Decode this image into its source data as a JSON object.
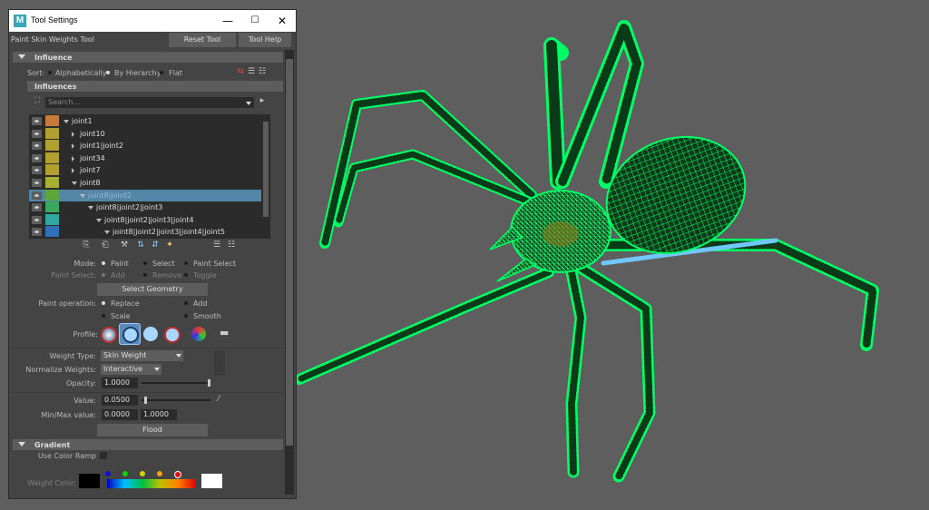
{
  "window": {
    "title": "Tool Settings",
    "logo_letter": "M",
    "minimize": "—",
    "maximize": "☐",
    "close": "✕"
  },
  "tool": {
    "name": "Paint Skin Weights Tool",
    "reset_label": "Reset Tool",
    "help_label": "Tool Help"
  },
  "influence": {
    "header": "Influence",
    "sort_label": "Sort:",
    "sort_options": [
      "Alphabetically",
      "By Hierarchy",
      "Flat"
    ],
    "sort_selected": "By Hierarchy",
    "influences_header": "Influences",
    "search_placeholder": "Search...",
    "tree": [
      {
        "name": "joint1",
        "color": "#c87a3a",
        "indent": 0,
        "arrow": "expanded",
        "selected": false
      },
      {
        "name": "joint10",
        "color": "#b0a030",
        "indent": 1,
        "arrow": "collapsed",
        "selected": false
      },
      {
        "name": "joint1|joint2",
        "color": "#b0a030",
        "indent": 1,
        "arrow": "collapsed",
        "selected": false
      },
      {
        "name": "joint34",
        "color": "#b0a030",
        "indent": 1,
        "arrow": "collapsed",
        "selected": false
      },
      {
        "name": "joint7",
        "color": "#b0a030",
        "indent": 1,
        "arrow": "collapsed",
        "selected": false
      },
      {
        "name": "joint8",
        "color": "#a8b030",
        "indent": 1,
        "arrow": "expanded",
        "selected": false
      },
      {
        "name": "joint8|joint2",
        "color": "#5aa83a",
        "indent": 2,
        "arrow": "expanded",
        "selected": true
      },
      {
        "name": "joint8|joint2|joint3",
        "color": "#3aa860",
        "indent": 3,
        "arrow": "expanded",
        "selected": false
      },
      {
        "name": "joint8|joint2|joint3|joint4",
        "color": "#30a8a0",
        "indent": 4,
        "arrow": "expanded",
        "selected": false
      },
      {
        "name": "joint8|joint2|joint3|joint4|joint5",
        "color": "#3070b8",
        "indent": 5,
        "arrow": "expanded",
        "selected": false
      }
    ]
  },
  "mode": {
    "label": "Mode:",
    "options": [
      "Paint",
      "Select",
      "Paint Select"
    ],
    "selected": "Paint",
    "paint_select_label": "Paint Select:",
    "paint_select_options": [
      "Add",
      "Remove",
      "Toggle"
    ],
    "select_geometry": "Select Geometry"
  },
  "paint_operation": {
    "label": "Paint operation:",
    "options": [
      "Replace",
      "Add",
      "Scale",
      "Smooth"
    ],
    "selected": "Replace"
  },
  "profile": {
    "label": "Profile:"
  },
  "weights": {
    "weight_type_label": "Weight Type:",
    "weight_type_value": "Skin Weight",
    "normalize_label": "Normalize Weights:",
    "normalize_value": "Interactive",
    "opacity_label": "Opacity:",
    "opacity_value": "1.0000",
    "opacity_level": 1.0,
    "value_label": "Value:",
    "value_value": "0.0500",
    "value_level": 0.05,
    "minmax_label": "Min/Max value:",
    "min_value": "0.0000",
    "max_value": "1.0000",
    "flood_label": "Flood"
  },
  "gradient": {
    "header": "Gradient",
    "use_color_ramp_label": "Use Color Ramp",
    "weight_color_label": "Weight Color:",
    "ramp_dot_colors": [
      "#1010d0",
      "#10d010",
      "#d0d010",
      "#f0a010",
      "#e01010"
    ]
  },
  "viewport": {
    "wire_color": "#00ff66",
    "background": "#5e5e5e"
  }
}
